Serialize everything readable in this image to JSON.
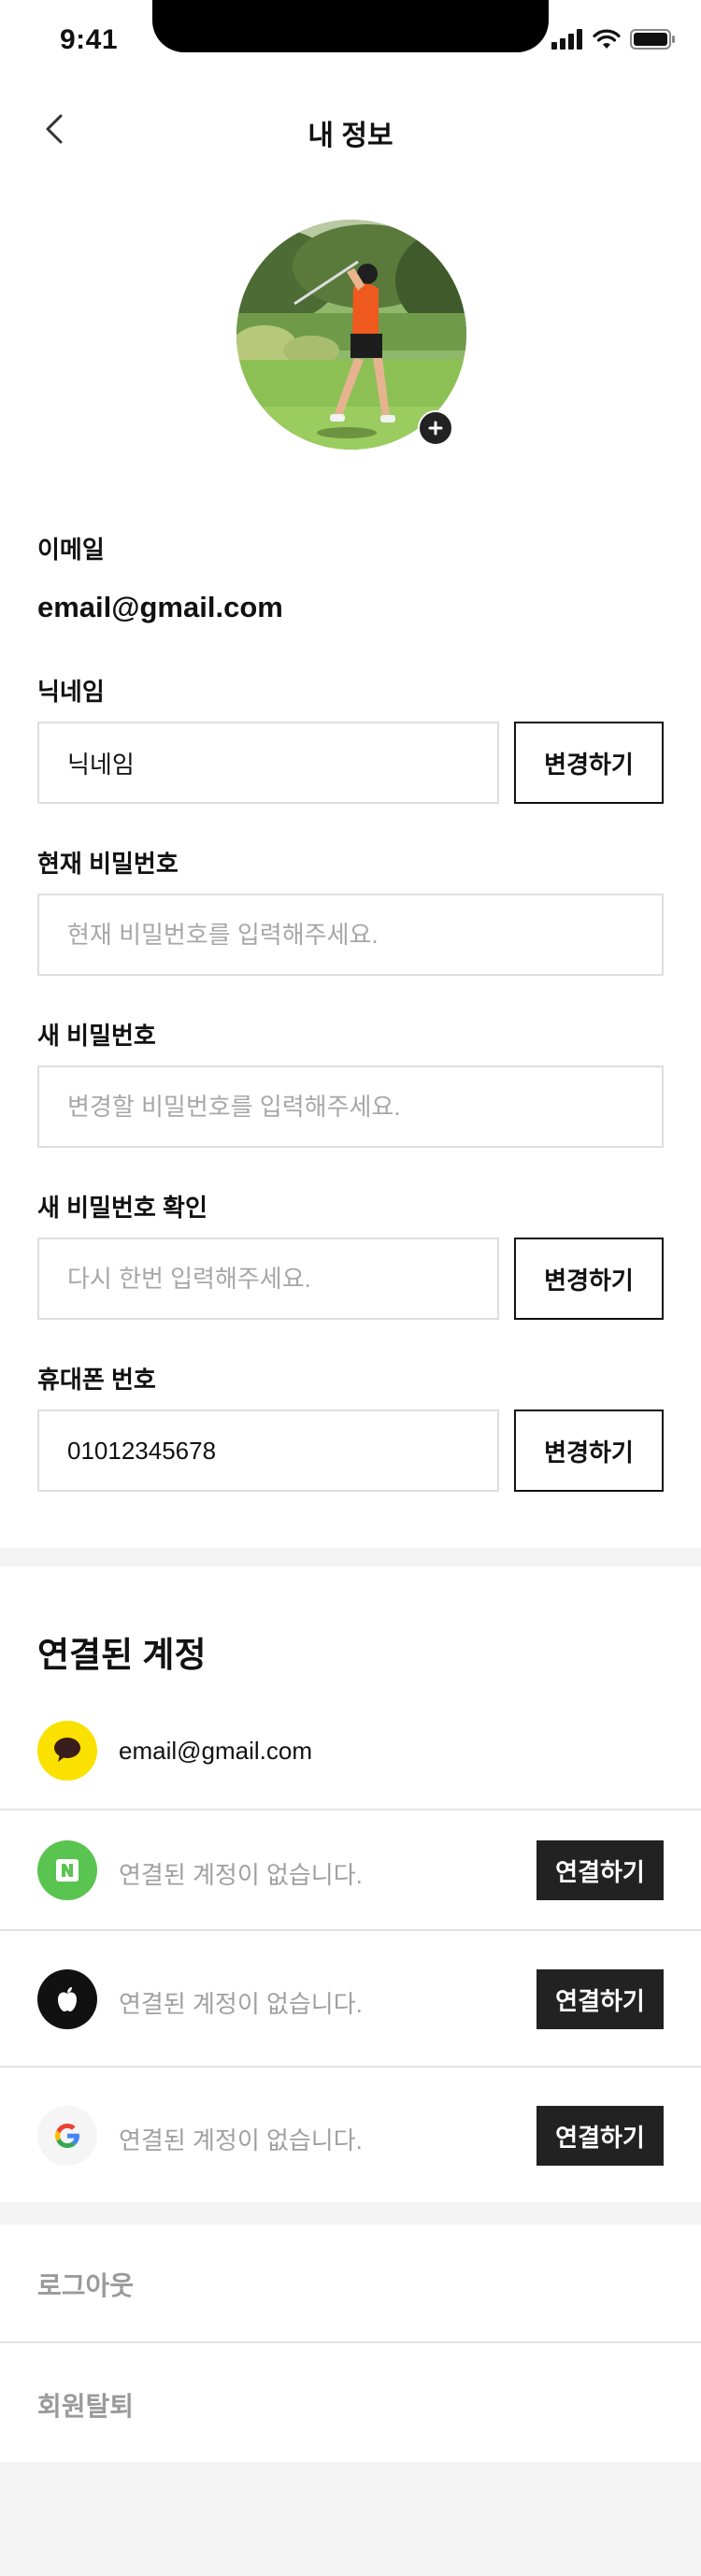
{
  "status_bar": {
    "time": "9:41"
  },
  "header": {
    "title": "내 정보"
  },
  "profile": {
    "email_label": "이메일",
    "email_value": "email@gmail.com",
    "nickname_label": "닉네임",
    "nickname_value": "닉네임",
    "nickname_button": "변경하기",
    "current_password_label": "현재 비밀번호",
    "current_password_placeholder": "현재 비밀번호를 입력해주세요.",
    "new_password_label": "새 비밀번호",
    "new_password_placeholder": "변경할 비밀번호를 입력해주세요.",
    "confirm_password_label": "새 비밀번호 확인",
    "confirm_password_placeholder": "다시 한번 입력해주세요.",
    "password_button": "변경하기",
    "phone_label": "휴대폰 번호",
    "phone_value": "01012345678",
    "phone_button": "변경하기"
  },
  "linked_accounts": {
    "title": "연결된 계정",
    "items": [
      {
        "provider_icon": "kakao-icon",
        "color": "#FAE100",
        "text": "email@gmail.com",
        "linked": true
      },
      {
        "provider_icon": "naver-icon",
        "color": "#5AC451",
        "text": "연결된 계정이 없습니다.",
        "button": "연결하기",
        "linked": false
      },
      {
        "provider_icon": "apple-icon",
        "color": "#111111",
        "text": "연결된 계정이 없습니다.",
        "button": "연결하기",
        "linked": false
      },
      {
        "provider_icon": "google-icon",
        "color": "#F5F5F5",
        "text": "연결된 계정이 없습니다.",
        "button": "연결하기",
        "linked": false
      }
    ]
  },
  "menu": {
    "logout": "로그아웃",
    "withdraw": "회원탈퇴"
  }
}
